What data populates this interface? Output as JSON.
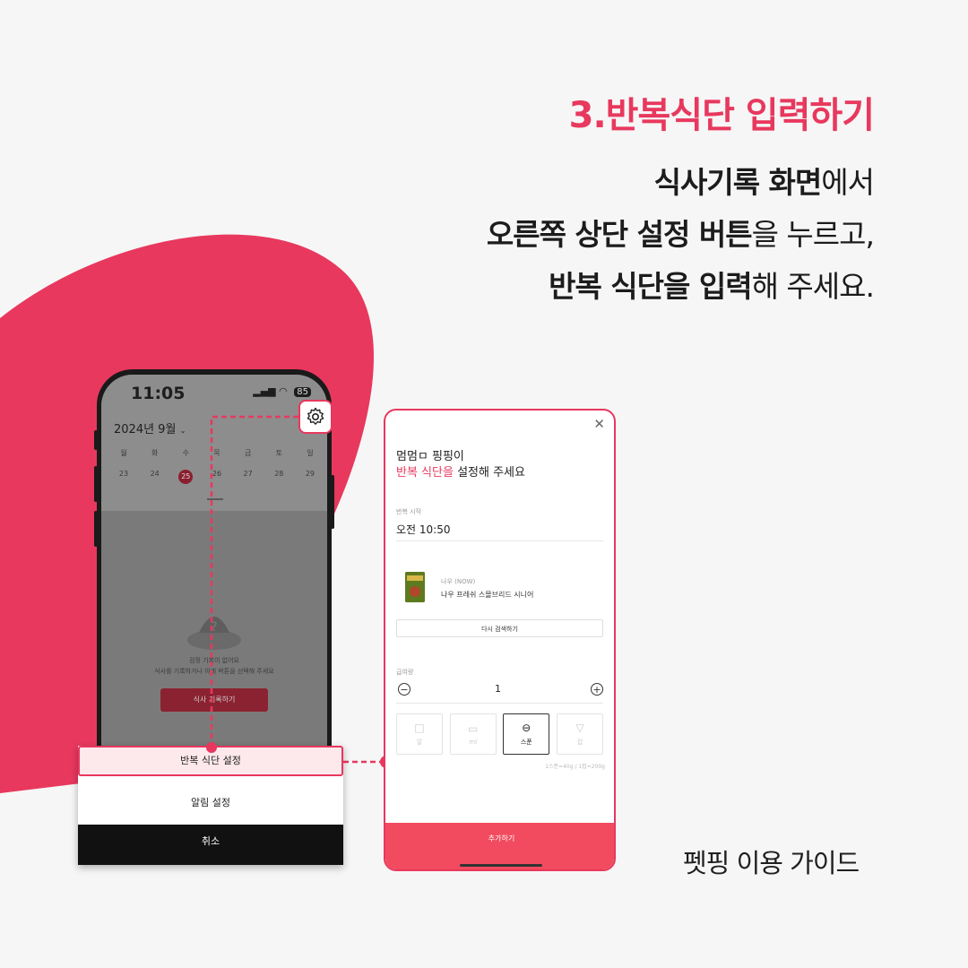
{
  "header": {
    "step_title": "3.반복식단 입력하기",
    "line1_bold": "식사기록 화면",
    "line1_rest": "에서",
    "line2_bold": "오른쪽 상단 설정 버튼",
    "line2_rest": "을 누르고,",
    "line3_bold": "반복 식단을 입력",
    "line3_rest": "해 주세요."
  },
  "footer": {
    "label": "펫핑 이용 가이드"
  },
  "phone1": {
    "time": "11:05",
    "battery": "85",
    "month": "2024년 9월",
    "weekdays": [
      "월",
      "화",
      "수",
      "목",
      "금",
      "토",
      "일"
    ],
    "dates": [
      "23",
      "24",
      "25",
      "26",
      "27",
      "28",
      "29"
    ],
    "selected_date": "25",
    "empty_text_1": "검정 기록이 없어요",
    "empty_text_2": "식사를 기록하거나 아래 버튼을 선택해 주세요",
    "record_button": "식사 기록하기",
    "icons": {
      "settings": "gear-icon",
      "signal": "signal-icon",
      "wifi": "wifi-icon"
    }
  },
  "action_sheet": {
    "repeat_diet": "반복 식단 설정",
    "notification": "알림 설정",
    "cancel": "취소"
  },
  "phone2": {
    "title_line1": "멈멈ㅁ 핑핑이",
    "title_highlight": "반복 식단을",
    "title_rest": " 설정해 주세요",
    "repeat_start_label": "반복 시작",
    "repeat_time": "오전 10:50",
    "product_brand": "나우 (NOW)",
    "product_name": "나우 프레쉬 스몰브리드 시니어",
    "research_button": "다시 검색하기",
    "amount_label": "급여량",
    "quantity": "1",
    "units": [
      {
        "label": "알",
        "icon": "□"
      },
      {
        "label": "ml",
        "icon": "▭"
      },
      {
        "label": "스푼",
        "icon": "⊖"
      },
      {
        "label": "컵",
        "icon": "▽"
      }
    ],
    "selected_unit": "스푼",
    "unit_note": "1스푼=40g / 1컵=200g",
    "add_button": "추가하기"
  },
  "colors": {
    "accent": "#e8385e",
    "add_button": "#f24b5f"
  }
}
